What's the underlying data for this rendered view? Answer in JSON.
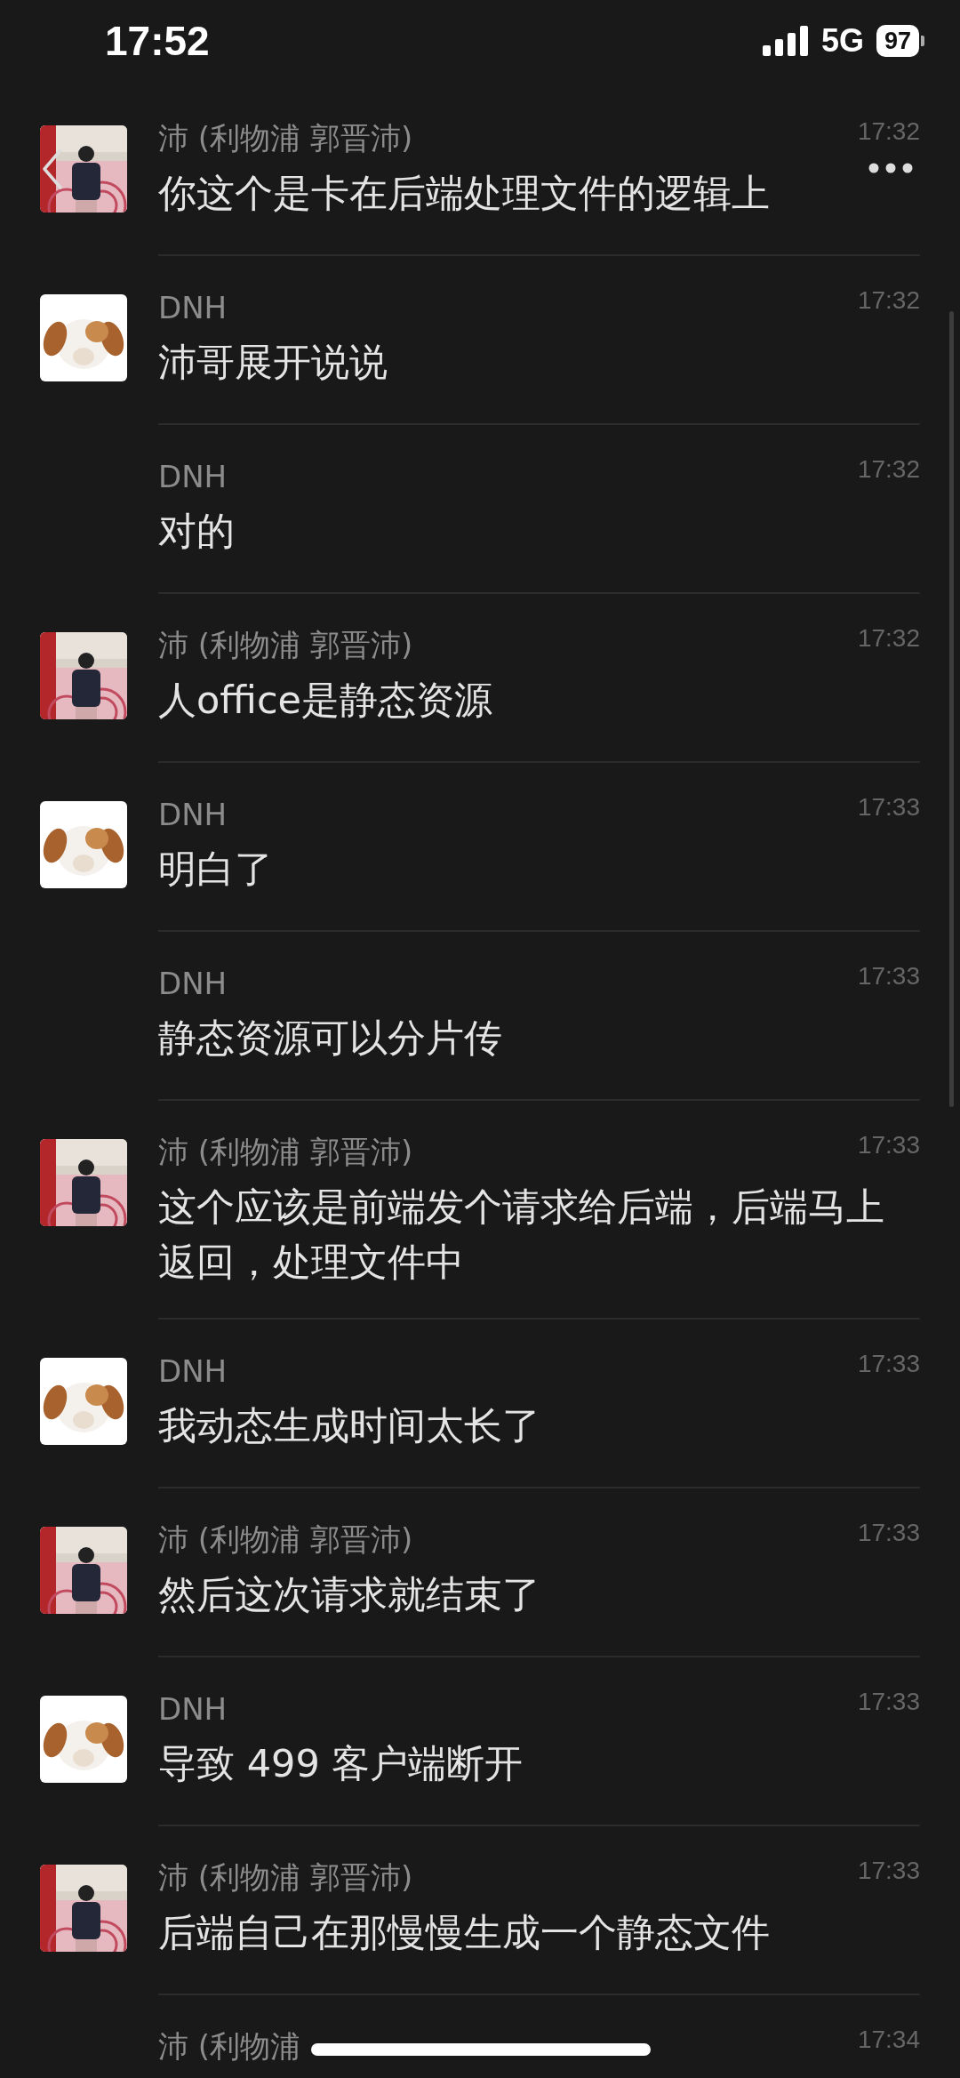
{
  "status_bar": {
    "time": "17:52",
    "network": "5G",
    "battery": "97"
  },
  "messages": [
    {
      "sender": "沛 (利物浦 郭晋沛)",
      "time": "17:32",
      "text": "你这个是卡在后端处理文件的逻辑上"
    },
    {
      "sender": "DNH",
      "time": "17:32",
      "text": "沛哥展开说说",
      "avatar": {
        "kind": "dog"
      }
    },
    {
      "sender": "DNH",
      "time": "17:32",
      "text": "对的"
    },
    {
      "sender": "沛 (利物浦 郭晋沛)",
      "time": "17:32",
      "text": "人office是静态资源"
    },
    {
      "sender": "DNH",
      "time": "17:33",
      "text": "明白了",
      "avatar": {
        "kind": "dog"
      }
    },
    {
      "sender": "DNH",
      "time": "17:33",
      "text": "静态资源可以分片传"
    },
    {
      "sender": "沛 (利物浦 郭晋沛)",
      "time": "17:33",
      "text": "这个应该是前端发个请求给后端，后端马上返回，处理文件中"
    },
    {
      "sender": "DNH",
      "time": "17:33",
      "text": "我动态生成时间太长了",
      "avatar": {
        "kind": "dog"
      }
    },
    {
      "sender": "沛 (利物浦 郭晋沛)",
      "time": "17:33",
      "text": "然后这次请求就结束了"
    },
    {
      "sender": "DNH",
      "time": "17:33",
      "text": "导致 499 客户端断开",
      "avatar": {
        "kind": "dog"
      }
    },
    {
      "sender": "沛 (利物浦 郭晋沛)",
      "time": "17:33",
      "text": "后端自己在那慢慢生成一个静态文件"
    },
    {
      "sender": "沛 (利物浦",
      "time": "17:34"
    }
  ]
}
